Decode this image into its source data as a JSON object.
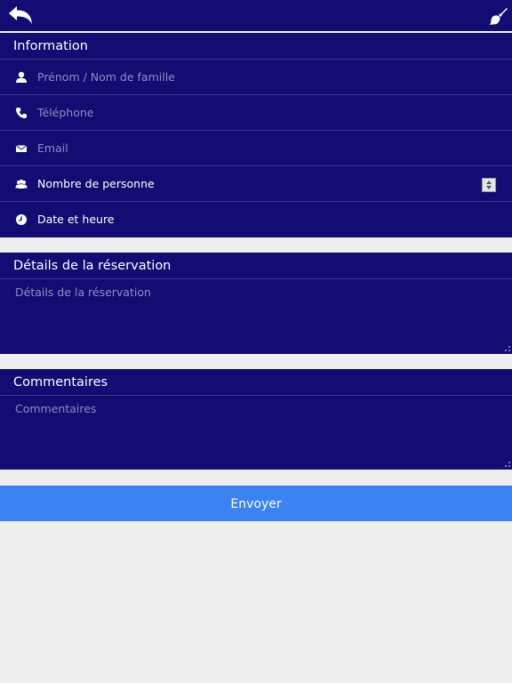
{
  "toolbar": {
    "back_icon": "back-arrow-icon",
    "clear_icon": "brush-icon"
  },
  "information": {
    "title": "Information",
    "fields": [
      {
        "icon": "user-icon",
        "placeholder": "Prénom / Nom de famille"
      },
      {
        "icon": "phone-icon",
        "placeholder": "Téléphone"
      },
      {
        "icon": "envelope-icon",
        "placeholder": "Email"
      },
      {
        "icon": "group-icon",
        "label": "Nombre de personne"
      },
      {
        "icon": "clock-icon",
        "label": "Date et heure"
      }
    ]
  },
  "details": {
    "title": "Détails de la réservation",
    "placeholder": "Détails de la réservation"
  },
  "comments": {
    "title": "Commentaires",
    "placeholder": "Commentaires"
  },
  "submit_label": "Envoyer",
  "colors": {
    "panel": "#130c72",
    "background": "#eeeeee",
    "button": "#3b82f2",
    "placeholder": "#8f8cc6"
  }
}
